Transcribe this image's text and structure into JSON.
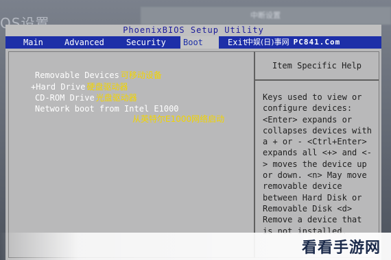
{
  "background": {
    "corner_text": "OS设置",
    "top_right_text": "中断设置"
  },
  "bios": {
    "title": "PhoenixBIOS Setup Utility",
    "menu": [
      {
        "label": "Main"
      },
      {
        "label": "Advanced"
      },
      {
        "label": "Security"
      },
      {
        "label": "Boot"
      },
      {
        "label": "Exit"
      }
    ],
    "watermark_cn": "中娱(日)事网",
    "watermark_brand": "PC841.Com",
    "boot_items": [
      {
        "label": "Removable Devices",
        "note": "可移动设备"
      },
      {
        "label": "+Hard Drive",
        "note": "硬盘驱动器"
      },
      {
        "label": "CD-ROM Drive",
        "note": "光盘驱动器"
      },
      {
        "label": "Network boot from Intel E1000",
        "note": ""
      }
    ],
    "network_note": "从英特尔E1000网络启动",
    "help_title": "Item Specific Help",
    "help_text": "Keys used to view or configure devices: <Enter> expands or collapses devices with a + or - <Ctrl+Enter> expands all <+> and <-> moves the device up or down. <n> May move removable device between Hard Disk or Removable Disk <d> Remove a device that is not installed."
  },
  "logo": "看看手游网"
}
